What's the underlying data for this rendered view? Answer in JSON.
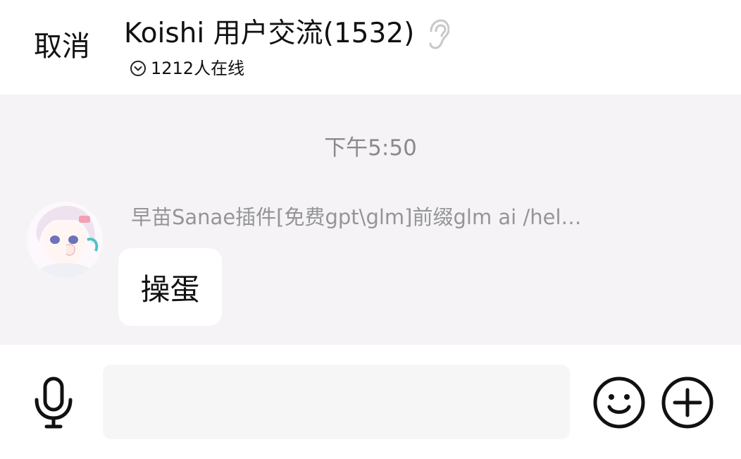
{
  "header": {
    "cancel_label": "取消",
    "group_title": "Koishi 用户交流(1532)",
    "online_text": "1212人在线",
    "icons": [
      "ear-icon",
      "chevron-down-circle-icon"
    ]
  },
  "chat": {
    "timestamp": "下午5:50",
    "messages": [
      {
        "sender": "早苗Sanae插件[免费gpt\\glm]前缀glm ai /hel…",
        "text": "操蛋",
        "avatar_icon": "anime-girl-avatar"
      }
    ]
  },
  "input_bar": {
    "placeholder": "",
    "value": "",
    "icons": [
      "microphone-icon",
      "smiley-icon",
      "plus-circle-icon"
    ]
  },
  "colors": {
    "chat_background": "#f5f3f6",
    "bubble_background": "#ffffff",
    "muted_text": "#959595",
    "input_background": "#f6f6f7"
  }
}
